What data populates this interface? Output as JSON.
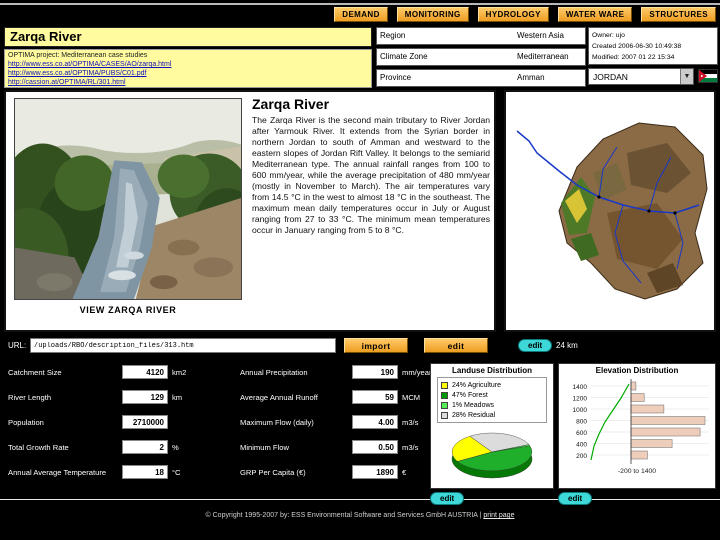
{
  "nav": {
    "buttons": [
      {
        "label": "DEMAND"
      },
      {
        "label": "MONITORING"
      },
      {
        "label": "HYDROLOGY"
      },
      {
        "label": "WATER WARE"
      },
      {
        "label": "STRUCTURES"
      }
    ]
  },
  "header": {
    "title": "Zarqa River",
    "links": [
      {
        "text": "OPTIMA project: Mediterranean case studies"
      },
      {
        "text": "http://www.ess.co.at/OPTIMA/CASES/AO/zarqa.html"
      },
      {
        "text": "http://www.ess.co.at/OPTIMA/PUBS/C01.pdf"
      },
      {
        "text": "http://cassion.at/OPTIMA/RL/301.html"
      }
    ],
    "fields": [
      {
        "label": "Region",
        "value": "Western Asia"
      },
      {
        "label": "Climate Zone",
        "value": "Mediterranean"
      },
      {
        "label": "Province",
        "value": "Amman"
      }
    ],
    "owner": "Owner: ujo",
    "created": "Created 2006-06-30 10:49:38",
    "modified": "Modified: 2007 01 22 15:34",
    "country_select": "JORDAN"
  },
  "main": {
    "photo_caption": "VIEW ZARQA RIVER",
    "description_title": "Zarqa River",
    "description": "The Zarqa River is the second main tributary to River Jordan after Yarmouk River. It extends from the Syrian border in northern Jordan to south of Amman and westward to the eastern slopes of Jordan Rift Valley. It belongs to the semiarid Mediterranean type. The annual rainfall ranges from 100 to 600 mm/year, while the average precipitation of 480 mm/year (mostly in November to March). The air temperatures vary from 14.5 °C in the west to almost 18 °C in the southeast. The maximum mean daily temperatures occur in July or August ranging from 27 to 33 °C. The minimum mean temperatures occur in January ranging from 5 to 8 °C."
  },
  "url_bar": {
    "label": "URL:",
    "value": "/uploads/RBO/description_files/313.htm",
    "import_label": "import",
    "edit_label": "edit"
  },
  "map": {
    "edit_label": "edit",
    "scale": "24 km"
  },
  "parameters": {
    "left": [
      {
        "label": "Catchment Size",
        "value": "4120",
        "unit": "km2"
      },
      {
        "label": "River Length",
        "value": "129",
        "unit": "km"
      },
      {
        "label": "Population",
        "value": "2710000",
        "unit": ""
      },
      {
        "label": "Total Growth Rate",
        "value": "2",
        "unit": "%"
      },
      {
        "label": "Annual Average Temperature",
        "value": "18",
        "unit": "°C"
      }
    ],
    "right": [
      {
        "label": "Annual Precipitation",
        "value": "190",
        "unit": "mm/year"
      },
      {
        "label": "Average Annual Runoff",
        "value": "59",
        "unit": "MCM"
      },
      {
        "label": "Maximum Flow (daily)",
        "value": "4.00",
        "unit": "m3/s"
      },
      {
        "label": "Minimum Flow",
        "value": "0.50",
        "unit": "m3/s"
      },
      {
        "label": "GRP Per Capita (€)",
        "value": "1890",
        "unit": "€"
      }
    ]
  },
  "landuse": {
    "title": "Landuse Distribution",
    "legend": [
      {
        "label": "24% Agriculture",
        "color": "#FFFF00"
      },
      {
        "label": "47% Forest",
        "color": "#009900"
      },
      {
        "label": "1% Meadows",
        "color": "#55EE55"
      },
      {
        "label": "28% Residual",
        "color": "#DCDCDC"
      }
    ],
    "edit_label": "edit"
  },
  "elevation": {
    "title": "Elevation Distribution",
    "edit_label": "edit"
  },
  "chart_data": [
    {
      "type": "pie",
      "title": "Landuse Distribution",
      "start_angle_deg": 150,
      "slices": [
        {
          "label": "Agriculture",
          "value": 24,
          "color": "#FFFF00"
        },
        {
          "label": "Residual",
          "value": 28,
          "color": "#DCDCDC"
        },
        {
          "label": "Meadows",
          "value": 1,
          "color": "#55EE55"
        },
        {
          "label": "Forest",
          "value": 47,
          "color": "#1FAF2A"
        }
      ]
    },
    {
      "type": "bar",
      "title": "Elevation Distribution",
      "orientation": "horizontal",
      "categories": [
        "1400",
        "1200",
        "1000",
        "800",
        "600",
        "400",
        "200"
      ],
      "values": [
        3,
        8,
        20,
        45,
        42,
        25,
        10
      ],
      "x_axis_note": "-200  to  1400"
    }
  ],
  "footer": {
    "copyright": "© Copyright 1995-2007 by: ESS Environmental Software and Services GmbH AUSTRIA",
    "separator": "|",
    "print": "print page"
  }
}
